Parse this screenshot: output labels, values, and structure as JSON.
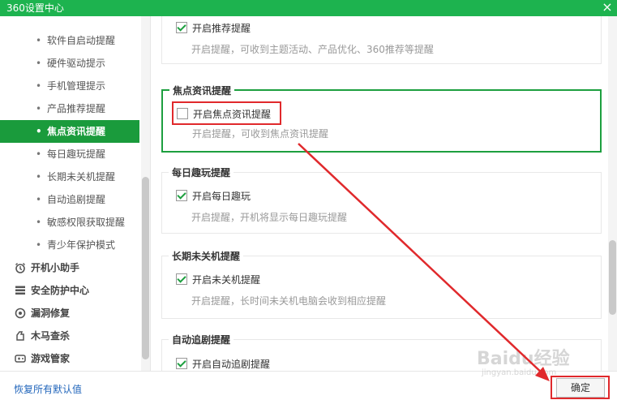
{
  "window": {
    "title": "360设置中心",
    "close_glyph": "×"
  },
  "sidebar": {
    "sub_items": [
      {
        "label": "软件自启动提醒"
      },
      {
        "label": "硬件驱动提示"
      },
      {
        "label": "手机管理提示"
      },
      {
        "label": "产品推荐提醒"
      },
      {
        "label": "焦点资讯提醒",
        "active": true
      },
      {
        "label": "每日趣玩提醒"
      },
      {
        "label": "长期未关机提醒"
      },
      {
        "label": "自动追剧提醒"
      },
      {
        "label": "敏感权限获取提醒"
      },
      {
        "label": "青少年保护模式"
      }
    ],
    "categories": [
      {
        "label": "开机小助手",
        "icon": "alarm-clock-icon"
      },
      {
        "label": "安全防护中心",
        "icon": "shield-grid-icon"
      },
      {
        "label": "漏洞修复",
        "icon": "patch-icon"
      },
      {
        "label": "木马查杀",
        "icon": "trojan-icon"
      },
      {
        "label": "游戏管家",
        "icon": "gamepad-icon"
      }
    ]
  },
  "content": {
    "groups": [
      {
        "title": "",
        "option_label": "开启推荐提醒",
        "checked": true,
        "description": "开启提醒，可收到主题活动、产品优化、360推荐等提醒"
      },
      {
        "title": "焦点资讯提醒",
        "option_label": "开启焦点资讯提醒",
        "checked": false,
        "description": "开启提醒，可收到焦点资讯提醒"
      },
      {
        "title": "每日趣玩提醒",
        "option_label": "开启每日趣玩",
        "checked": true,
        "description": "开启提醒，开机将显示每日趣玩提醒"
      },
      {
        "title": "长期未关机提醒",
        "option_label": "开启未关机提醒",
        "checked": true,
        "description": "开启提醒，长时间未关机电脑会收到相应提醒"
      },
      {
        "title": "自动追剧提醒",
        "option_label": "开启自动追剧提醒",
        "checked": true,
        "description": ""
      }
    ]
  },
  "footer": {
    "restore_label": "恢复所有默认值",
    "ok_label": "确定"
  },
  "watermark": {
    "main": "Baidu经验",
    "sub": "jingyan.baidu.com"
  },
  "colors": {
    "brand_green": "#1db34f",
    "active_green": "#1a9b3c",
    "highlight_red": "#e0292c"
  }
}
